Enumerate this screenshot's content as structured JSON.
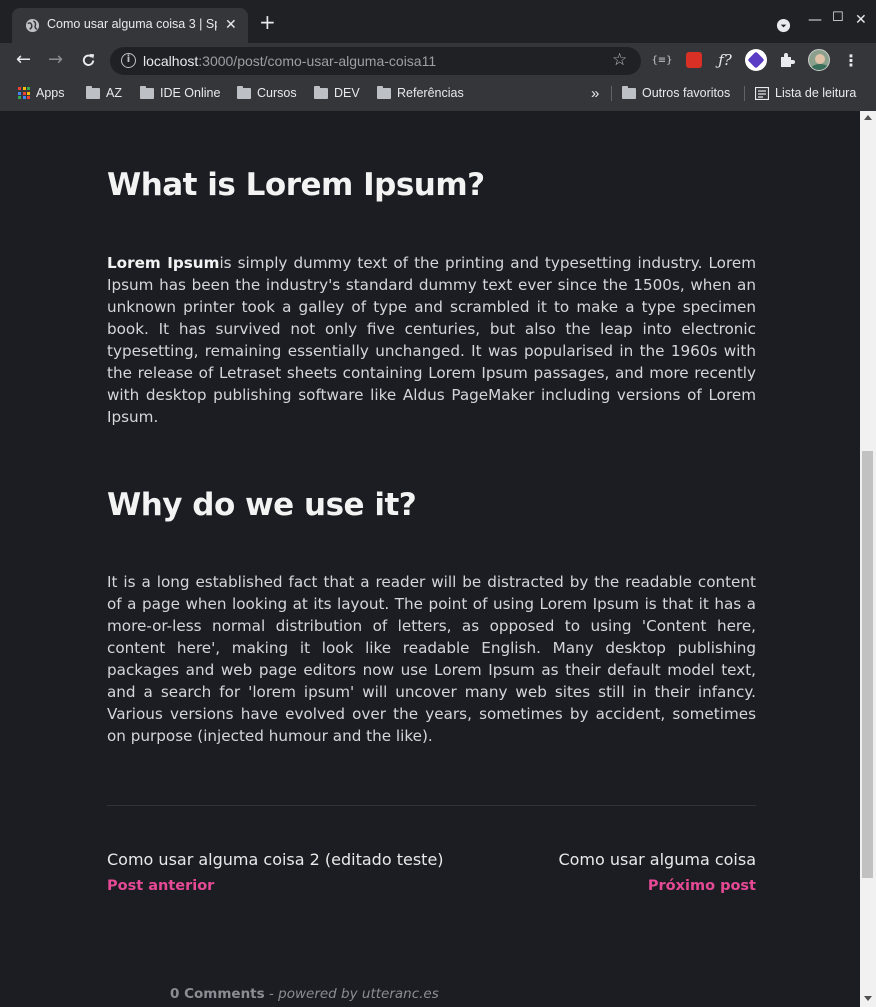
{
  "browser": {
    "tab_title": "Como usar alguma coisa 3 | Sp",
    "url_host": "localhost",
    "url_path": ":3000/post/como-usar-alguma-coisa11",
    "bookmarks": [
      {
        "label": "Apps",
        "type": "apps"
      },
      {
        "label": "AZ",
        "type": "folder"
      },
      {
        "label": "IDE Online",
        "type": "folder"
      },
      {
        "label": "Cursos",
        "type": "folder"
      },
      {
        "label": "DEV",
        "type": "folder"
      },
      {
        "label": "Referências",
        "type": "folder"
      }
    ],
    "bookmarks_overflow": "»",
    "other_bookmarks": "Outros favoritos",
    "reading_list": "Lista de leitura",
    "extension_icons": [
      "json-viewer-icon",
      "red-extension-icon",
      "function-icon",
      "hexagon-extension-icon",
      "puzzle-icon",
      "avatar"
    ]
  },
  "article": {
    "section1": {
      "heading": "What is Lorem Ipsum?",
      "bold_lead": "Lorem Ipsum",
      "text": "is simply dummy text of the printing and typesetting industry. Lorem Ipsum has been the industry's standard dummy text ever since the 1500s, when an unknown printer took a galley of type and scrambled it to make a type specimen book. It has survived not only five centuries, but also the leap into electronic typesetting, remaining essentially unchanged. It was popularised in the 1960s with the release of Letraset sheets containing Lorem Ipsum passages, and more recently with desktop publishing software like Aldus PageMaker including versions of Lorem Ipsum."
    },
    "section2": {
      "heading": "Why do we use it?",
      "text": "It is a long established fact that a reader will be distracted by the readable content of a page when looking at its layout. The point of using Lorem Ipsum is that it has a more-or-less normal distribution of letters, as opposed to using 'Content here, content here', making it look like readable English. Many desktop publishing packages and web page editors now use Lorem Ipsum as their default model text, and a search for 'lorem ipsum' will uncover many web sites still in their infancy. Various versions have evolved over the years, sometimes by accident, sometimes on purpose (injected humour and the like)."
    }
  },
  "post_nav": {
    "prev_title": "Como usar alguma coisa 2 (editado teste)",
    "prev_label": "Post anterior",
    "next_title": "Como usar alguma coisa",
    "next_label": "Próximo post"
  },
  "comments": {
    "count_label": "0 Comments",
    "separator": " - ",
    "powered_by": "powered by utteranc.es"
  },
  "colors": {
    "page_bg": "#1b1d22",
    "accent": "#e64995",
    "heading": "#f3f3f3",
    "body_text": "#d4d6da"
  }
}
